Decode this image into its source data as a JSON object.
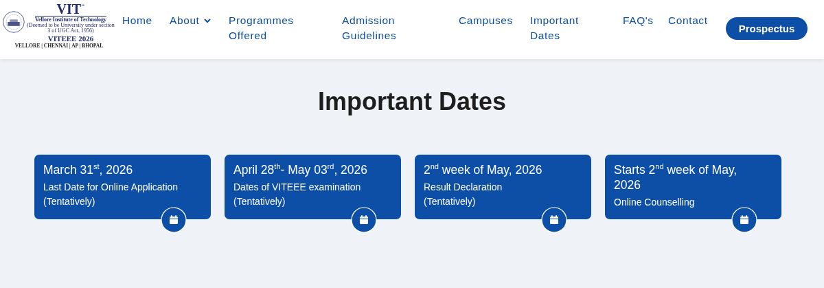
{
  "logo": {
    "mark": "VIT",
    "registered": "®",
    "name": "Vellore Institute of Technology",
    "note": "(Deemed to be University under section 3 of UGC Act, 1956)",
    "event": "VITEEE 2026",
    "campuses": "VELLORE | CHENNAI | AP | BHOPAL"
  },
  "nav": [
    {
      "label": "Home",
      "kind": "link"
    },
    {
      "label": "About",
      "kind": "dropdown"
    },
    {
      "label": "Programmes Offered",
      "kind": "link"
    },
    {
      "label": "Admission Guidelines",
      "kind": "link"
    },
    {
      "label": "Campuses",
      "kind": "link"
    },
    {
      "label": "Important Dates",
      "kind": "link"
    },
    {
      "label": "FAQ's",
      "kind": "link"
    },
    {
      "label": "Contact",
      "kind": "link"
    }
  ],
  "cta": "Prospectus",
  "heading": "Important Dates",
  "cards": [
    {
      "date": "March 31$^{st}$, 2026",
      "description": "Last Date for Online Application",
      "note": "(Tentatively)"
    },
    {
      "date": "April 28$^{th}$- May 03$^{rd}$, 2026",
      "description": "Dates of VITEEE examination",
      "note": "(Tentatively)"
    },
    {
      "date": "2$^{nd}$ week of May, 2026",
      "description": "Result Declaration",
      "note": "(Tentatively)"
    },
    {
      "date": "Starts 2$^{nd}$ week of May, 2026",
      "description": "Online Counselling"
    }
  ]
}
